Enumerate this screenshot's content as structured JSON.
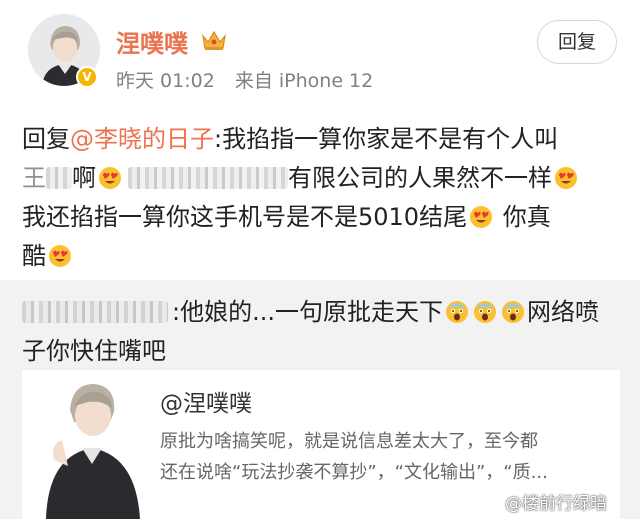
{
  "post": {
    "author": "涅噗噗",
    "badge_icon": "crown-icon",
    "verified_icon": "vip-badge",
    "time": "昨天 01:02",
    "source": "来自 iPhone 12",
    "reply_button": "回复",
    "body": {
      "prefix": "回复",
      "mention": "@李晓的日子",
      "line1_rest": ":我掐指一算你家是不是有个人叫",
      "line2_a": "王",
      "line2_b": "啊",
      "line2_c": "有限公司的人果然不一样",
      "line3": "我还掐指一算你这手机号是不是5010结尾",
      "line3_b": " 你真",
      "line4": "酷"
    }
  },
  "quote": {
    "text_a": ":他娘的...一句原批走天下",
    "text_b": "网络喷",
    "text_c": "子你快住嘴吧"
  },
  "card": {
    "title": "@涅噗噗",
    "desc_line1": "原批为啥搞笑呢，就是说信息差太大了，至今都",
    "desc_line2": "还在说啥“玩法抄袭不算抄”，“文化输出”，“质..."
  },
  "watermark": "@楼前行绿暗",
  "colors": {
    "accent": "#eb7350",
    "quote_bg": "#f2f2f2",
    "meta": "#808080"
  }
}
